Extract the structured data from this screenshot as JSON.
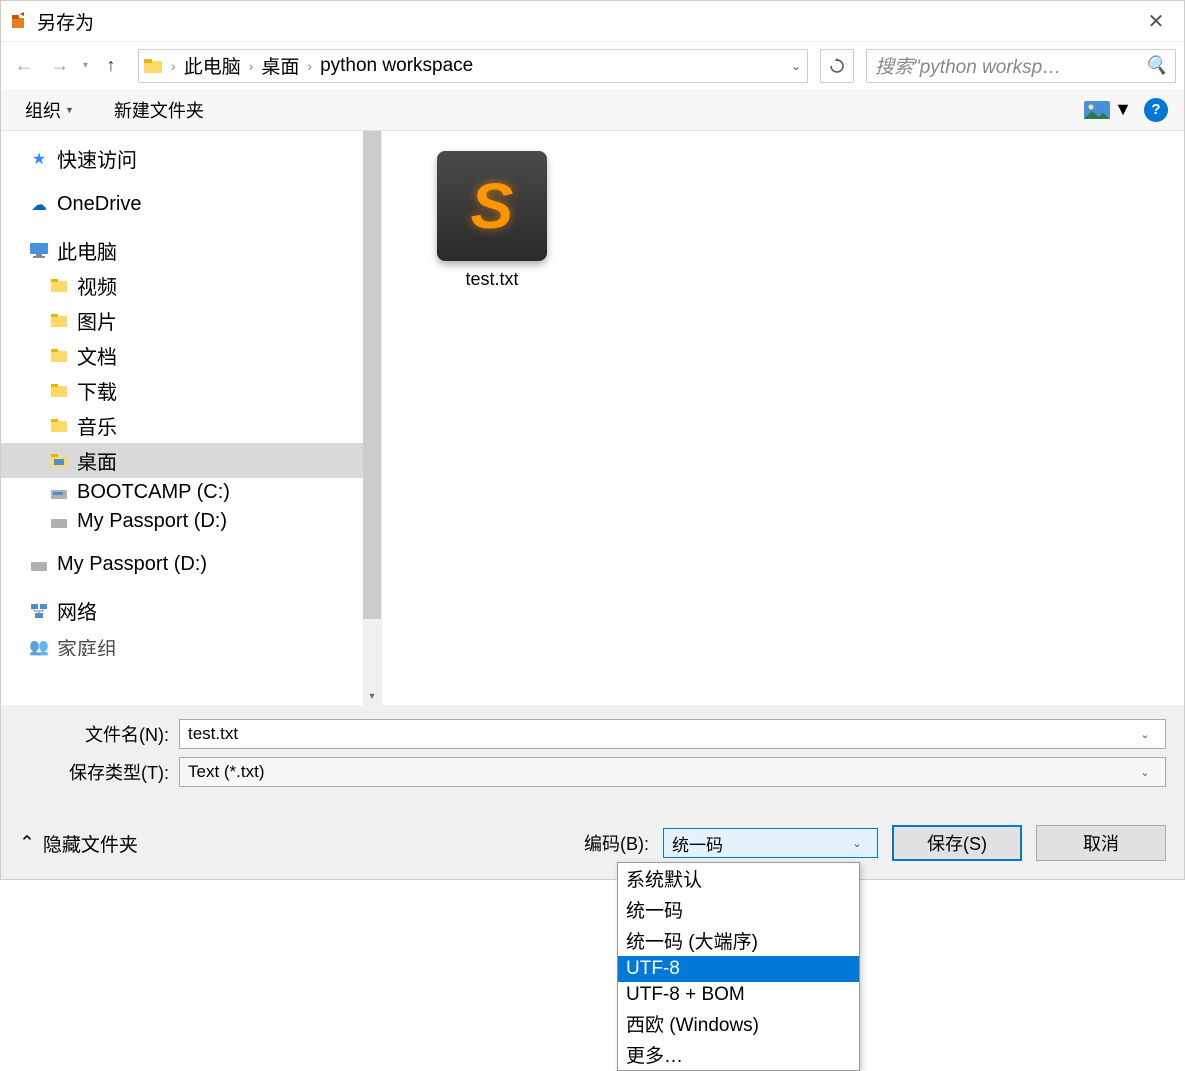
{
  "titlebar": {
    "title": "另存为"
  },
  "nav": {
    "breadcrumb": [
      "此电脑",
      "桌面",
      "python workspace"
    ],
    "search_placeholder": "搜索\"python worksp…"
  },
  "toolbar": {
    "organize": "组织",
    "new_folder": "新建文件夹"
  },
  "sidebar": {
    "items": [
      {
        "label": "快速访问",
        "icon": "star",
        "level": 0
      },
      {
        "label": "OneDrive",
        "icon": "cloud",
        "level": 0
      },
      {
        "label": "此电脑",
        "icon": "pc",
        "level": 0
      },
      {
        "label": "视频",
        "icon": "folder",
        "level": 1
      },
      {
        "label": "图片",
        "icon": "folder",
        "level": 1
      },
      {
        "label": "文档",
        "icon": "folder",
        "level": 1
      },
      {
        "label": "下载",
        "icon": "folder",
        "level": 1
      },
      {
        "label": "音乐",
        "icon": "folder",
        "level": 1
      },
      {
        "label": "桌面",
        "icon": "folder",
        "level": 1,
        "selected": true
      },
      {
        "label": "BOOTCAMP (C:)",
        "icon": "drive",
        "level": 1
      },
      {
        "label": "My Passport (D:)",
        "icon": "drive",
        "level": 1
      },
      {
        "label": "My Passport (D:)",
        "icon": "drive",
        "level": 0
      },
      {
        "label": "网络",
        "icon": "network",
        "level": 0
      },
      {
        "label": "家庭组",
        "icon": "homegroup",
        "level": 0
      }
    ]
  },
  "content": {
    "files": [
      {
        "name": "test.txt",
        "icon": "sublime"
      }
    ]
  },
  "form": {
    "filename_label": "文件名(N):",
    "filename_value": "test.txt",
    "filetype_label": "保存类型(T):",
    "filetype_value": "Text (*.txt)",
    "encoding_label": "编码(B):",
    "encoding_value": "统一码",
    "encoding_options": [
      "系统默认",
      "统一码",
      "统一码 (大端序)",
      "UTF-8",
      "UTF-8 + BOM",
      "西欧 (Windows)",
      "更多…"
    ],
    "encoding_highlighted": "UTF-8",
    "hide_folders": "隐藏文件夹",
    "save": "保存(S)",
    "cancel": "取消"
  }
}
